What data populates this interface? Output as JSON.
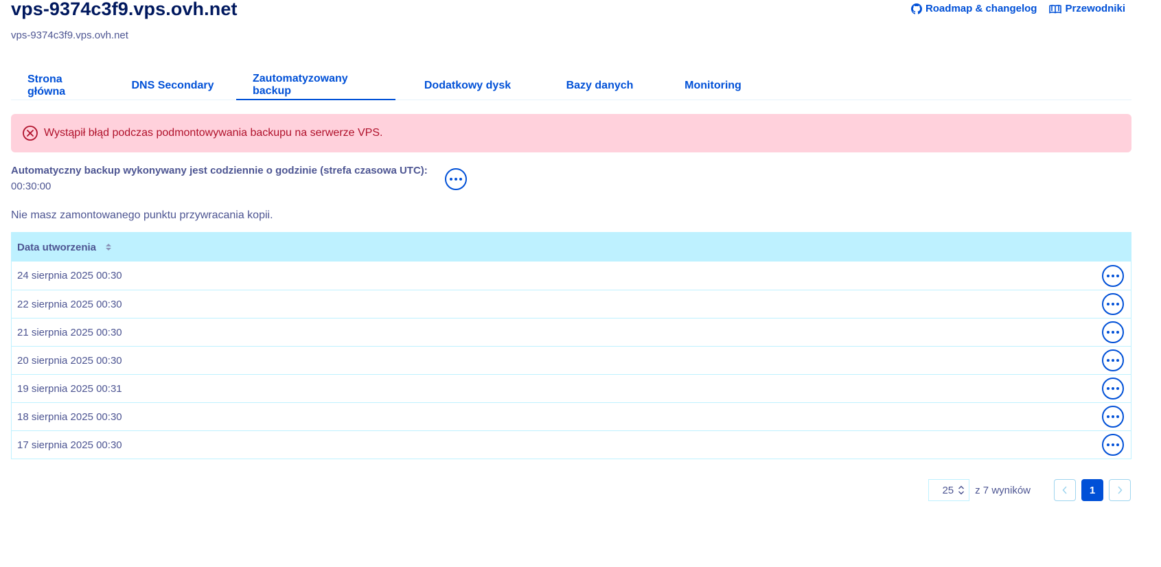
{
  "header": {
    "title": "vps-9374c3f9.vps.ovh.net",
    "subtitle": "vps-9374c3f9.vps.ovh.net",
    "links": [
      {
        "label": "Roadmap & changelog",
        "icon": "github-icon"
      },
      {
        "label": "Przewodniki",
        "icon": "book-icon"
      }
    ]
  },
  "tabs": [
    {
      "label": "Strona główna",
      "active": false
    },
    {
      "label": "DNS Secondary",
      "active": false
    },
    {
      "label": "Zautomatyzowany backup",
      "active": true
    },
    {
      "label": "Dodatkowy dysk",
      "active": false
    },
    {
      "label": "Bazy danych",
      "active": false
    },
    {
      "label": "Monitoring",
      "active": false
    }
  ],
  "alert": {
    "type": "error",
    "message": "Wystąpił błąd podczas podmontowywania backupu na serwerze VPS.",
    "color": "#ffd1dc"
  },
  "backup": {
    "label": "Automatyczny backup wykonywany jest codziennie o godzinie (strefa czasowa UTC):",
    "time": "00:30:00",
    "no_mount_text": "Nie masz zamontowanego punktu przywracania kopii."
  },
  "table": {
    "columns": [
      {
        "label": "Data utworzenia",
        "sortable": true
      }
    ],
    "rows": [
      "24 sierpnia 2025 00:30",
      "22 sierpnia 2025 00:30",
      "21 sierpnia 2025 00:30",
      "20 sierpnia 2025 00:30",
      "19 sierpnia 2025 00:31",
      "18 sierpnia 2025 00:30",
      "17 sierpnia 2025 00:30"
    ]
  },
  "pagination": {
    "per_page": "25",
    "results_text": "z 7 wyników",
    "current_page": "1"
  },
  "colors": {
    "primary": "#0050d7",
    "title": "#00185e",
    "text": "#4d5592",
    "table_header": "#bef1ff"
  }
}
